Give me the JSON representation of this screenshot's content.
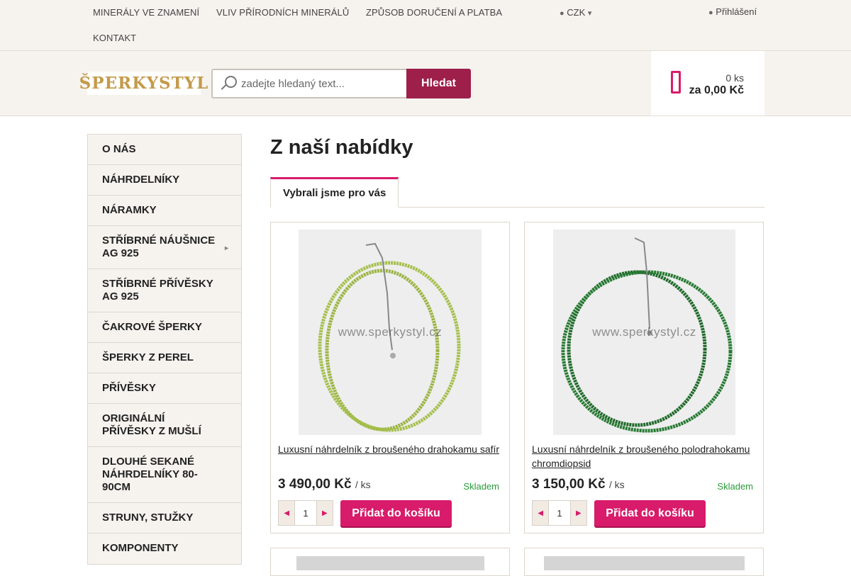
{
  "topnav": {
    "links": [
      "MINERÁLY VE ZNAMENÍ",
      "VLIV PŘÍRODNÍCH MINERÁLŮ",
      "ZPŮSOB DORUČENÍ A PLATBA",
      "KONTAKT"
    ],
    "currency": "CZK",
    "currency_icon": "globe-icon",
    "login": "Přihlášení",
    "login_icon": "user-icon"
  },
  "header": {
    "logo": "ŠPERKYSTYL",
    "search_placeholder": "zadejte hledaný text...",
    "search_button": "Hledat",
    "cart_count": "0 ks",
    "cart_total": "za 0,00 Kč",
    "accent_color": "#d81b6a",
    "search_button_color": "#9d1f4a"
  },
  "sidebar": {
    "items": [
      {
        "label": "O NÁS"
      },
      {
        "label": "NÁHRDELNÍKY"
      },
      {
        "label": "NÁRAMKY"
      },
      {
        "label": "STŘÍBRNÉ NÁUŠNICE AG 925",
        "submenu": true
      },
      {
        "label": "STŘÍBRNÉ PŘÍVĚSKY AG 925"
      },
      {
        "label": "ČAKROVÉ ŠPERKY"
      },
      {
        "label": "ŠPERKY Z PEREL"
      },
      {
        "label": "PŘÍVĚSKY"
      },
      {
        "label": "ORIGINÁLNÍ PŘÍVĚSKY Z MUŠLÍ"
      },
      {
        "label": "DLOUHÉ SEKANÉ NÁHRDELNÍKY 80-90CM"
      },
      {
        "label": "STRUNY, STUŽKY"
      },
      {
        "label": "KOMPONENTY"
      }
    ]
  },
  "main": {
    "title": "Z naší nabídky",
    "tab": "Vybrali jsme pro vás",
    "products": [
      {
        "name": "Luxusní náhrdelník z broušeného drahokamu safír",
        "price": "3 490,00 Kč",
        "unit": "/ ks",
        "stock": "Skladem",
        "qty": "1",
        "add_label": "Přidat do košíku",
        "watermark": "www.sperkystyl.cz",
        "bead_color": "#9cb544"
      },
      {
        "name": "Luxusní náhrdelník z broušeného polodrahokamu chromdiopsid",
        "price": "3 150,00 Kč",
        "unit": "/ ks",
        "stock": "Skladem",
        "qty": "1",
        "add_label": "Přidat do košíku",
        "watermark": "www.sperkystyl.cz",
        "bead_color": "#1f6a2a"
      }
    ]
  }
}
